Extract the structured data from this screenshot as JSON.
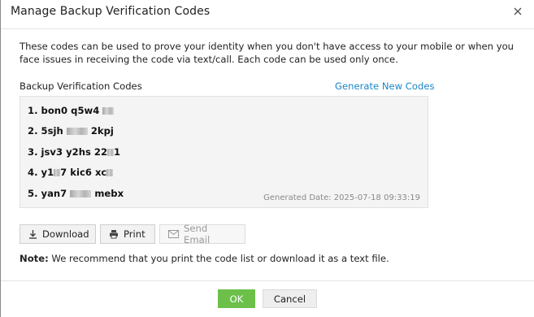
{
  "dialog": {
    "title": "Manage Backup Verification Codes",
    "close_icon": "close-icon"
  },
  "description": "These codes can be used to prove your identity when you don't have access to your mobile or when you face issues in receiving the code via text/call. Each code can be used only once.",
  "codes_section": {
    "label": "Backup Verification Codes",
    "generate_link": "Generate New Codes",
    "codes": [
      {
        "num": "1.",
        "part_a": "bon0",
        "part_b": "q5w4",
        "part_c": ""
      },
      {
        "num": "2.",
        "part_a": "5sjh",
        "part_b": "",
        "part_c": "2kpj"
      },
      {
        "num": "3.",
        "part_a": "jsv3",
        "part_b": "y2hs",
        "part_c": "22",
        "part_d": "1"
      },
      {
        "num": "4.",
        "part_a": "y1",
        "part_b": "7",
        "part_c": "kic6",
        "part_d": "xc"
      },
      {
        "num": "5.",
        "part_a": "yan7",
        "part_b": "",
        "part_c": "mebx"
      }
    ],
    "generated_date": "Generated Date: 2025-07-18 09:33:19"
  },
  "actions": {
    "download_label": "Download",
    "print_label": "Print",
    "send_email_label": "Send Email"
  },
  "note": {
    "prefix": "Note:",
    "text": " We recommend that you print the code list or download it as a text file."
  },
  "footer": {
    "ok_label": "OK",
    "cancel_label": "Cancel"
  },
  "colors": {
    "link": "#1a86c8",
    "ok_button": "#6cc04a",
    "code_box_bg": "#f4f4f4"
  }
}
